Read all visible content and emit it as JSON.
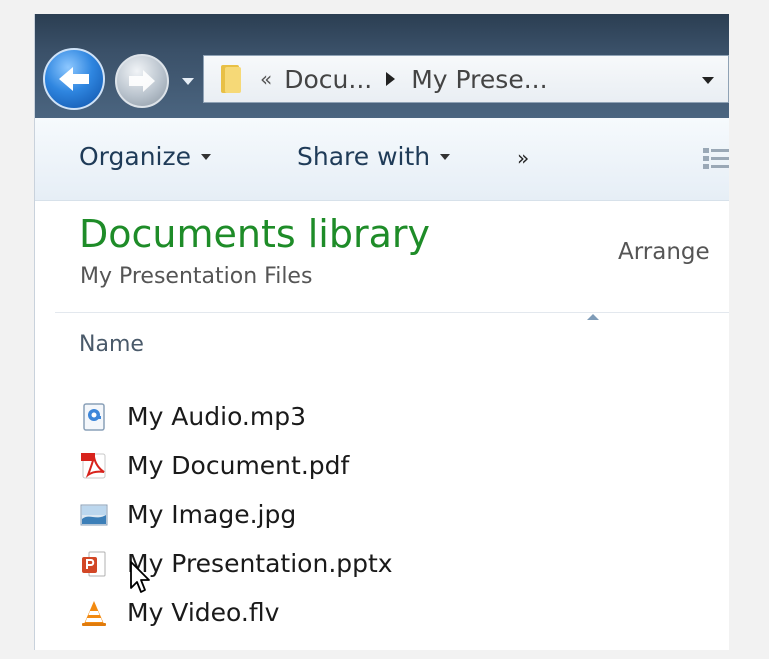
{
  "address_bar": {
    "overflow_marker": "«",
    "crumbs": [
      "Docu...",
      "My Prese..."
    ]
  },
  "toolbar": {
    "organize": "Organize",
    "share_with": "Share with",
    "more": "»"
  },
  "library": {
    "title": "Documents library",
    "subtitle": "My Presentation Files",
    "arrange_label": "Arrange"
  },
  "columns": {
    "name": "Name"
  },
  "files": [
    {
      "name": "My Audio.mp3",
      "icon": "audio-file-icon"
    },
    {
      "name": "My Document.pdf",
      "icon": "pdf-file-icon"
    },
    {
      "name": "My Image.jpg",
      "icon": "image-file-icon"
    },
    {
      "name": "My Presentation.pptx",
      "icon": "powerpoint-file-icon"
    },
    {
      "name": "My Video.flv",
      "icon": "vlc-file-icon"
    }
  ],
  "colors": {
    "library_title": "#1e8c28",
    "toolbar_text": "#1f3b58",
    "titlebar": "#3a5068"
  }
}
